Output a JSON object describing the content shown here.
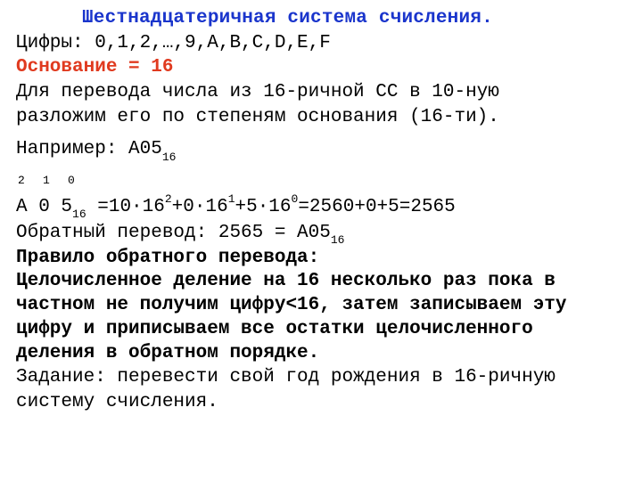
{
  "title": "Шестнадцатеричная система счисления.",
  "digits_line": "Цифры: 0,1,2,…,9,A,B,C,D,E,F",
  "base_line": "Основание = 16",
  "explain1": "Для перевода числа из 16-ричной СС в 10-ную",
  "explain2": "разложим его по степеням основания (16-ти).",
  "example_label": "Например: A05",
  "example_sub": "16",
  "positions": {
    "p2": "2",
    "p1": "1",
    "p0": "0"
  },
  "calc_prefix": "A 0 5",
  "calc_sub": "16",
  "calc_body": " =10·16",
  "calc_e2": "2",
  "calc_mid1": "+0·16",
  "calc_e1": "1",
  "calc_mid2": "+5·16",
  "calc_e0": "0",
  "calc_tail": "=2560+0+5=2565",
  "reverse_line": "Обратный перевод: 2565 = A05",
  "reverse_sub": "16",
  "rule_title": "Правило обратного перевода:",
  "rule_l1": "Целочисленное деление на 16 несколько раз пока в",
  "rule_l2": "частном не получим цифру<16, затем записываем эту",
  "rule_l3": "цифру и приписываем все остатки целочисленного",
  "rule_l4": "деления в обратном порядке.",
  "task_l1": "Задание: перевести свой год рождения в 16-ричную",
  "task_l2": "систему счисления."
}
